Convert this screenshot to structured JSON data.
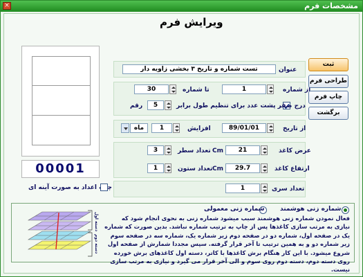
{
  "window": {
    "title": "مشخصات فرم"
  },
  "form": {
    "heading": "ویرایش فرم"
  },
  "title_field": {
    "label": "عنوان",
    "value": "تست شماره و تاریخ ۳ بخشی زاویه دار"
  },
  "numbering": {
    "from_label": "از شماره",
    "from_value": "1",
    "to_label": "تا شماره",
    "to_value": "30",
    "zero_pad_label": "درج صفر پشت عدد برای تنظیم طول برابر",
    "zero_pad_checked": true,
    "digits_label": "رقم",
    "digits_value": "5"
  },
  "date": {
    "from_label": "از تاریخ",
    "from_value": "89/01/01",
    "increment_label": "افزایش",
    "increment_value": "1",
    "unit_value": "ماه"
  },
  "paper": {
    "width_label": "عرض کاغذ",
    "width_value": "21",
    "width_unit": "Cm",
    "rows_label": "تعداد سطر",
    "rows_value": "3",
    "height_label": "ارتفاع کاغذ",
    "height_value": "29.7",
    "height_unit": "Cm",
    "cols_label": "تعداد ستون",
    "cols_value": "1"
  },
  "series": {
    "label": "تعداد سری",
    "value": "1"
  },
  "buttons": {
    "save": "ثبت",
    "design": "طراحی فرم",
    "print": "چاپ فرم",
    "back": "برگشت"
  },
  "preview": {
    "counter_text": "00001"
  },
  "mirror": {
    "label": "چاپ اعداد به صورت آینه ای",
    "checked": false
  },
  "numbering_mode": {
    "smart_label": "شماره زنی هوشمند",
    "smart_selected": true,
    "normal_label": "شماره زنی معمولی",
    "normal_selected": false
  },
  "illustration": {
    "layer1": "دسته اول",
    "layer2": "دسته دوم"
  },
  "description": "فعال نمودن شماره زنی هوشمند سبب میشود شماره زنی به نحوی انجام شود که نیازی به مرتب سازی کاغذها پس از چاپ به ترتیب شماره نباشد. بدین صورت که شماره یک در صفحه اول، شماره دو در صفحه دوم زیر شماره یک، شماره سه در صفحه سوم زیر شماره دو و به همین ترتیب تا آخر قرار گرفته. سپس مجددا شمارش از صفحه اول شروع میشود. با این کار هنگام برش کاغذها با کاتر، دسته اول کاغذهای برش خورده روی دسته دوم، دسته دوم روی سوم و الی آخر قرار می گیرد و نیازی به مرتب سازی نیست.",
  "colors": {
    "titlebar": "#1f8a1f",
    "accent": "#0a0a6e",
    "primary_button": "#f7c46c"
  }
}
